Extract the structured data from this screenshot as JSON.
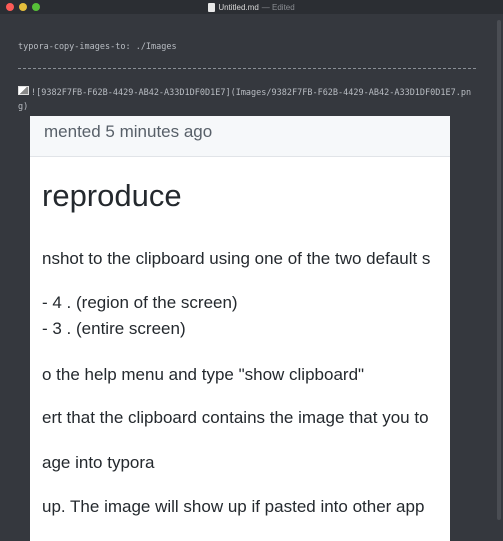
{
  "window": {
    "title": "Untitled.md",
    "status": "— Edited"
  },
  "editor": {
    "frontmatter": "typora-copy-images-to: ./Images",
    "image_markdown": "![9382F7FB-F62B-4429-AB42-A33D1DF0D1E7](Images/9382F7FB-F62B-4429-AB42-A33D1DF0D1E7.png)"
  },
  "screenshot": {
    "header": "mented 5 minutes ago",
    "heading": "reproduce",
    "lines": [
      "nshot to the clipboard using one of the two default s",
      "- 4 . (region of the screen)",
      "- 3 . (entire screen)",
      "o the help menu and type \"show clipboard\"",
      "ert that the clipboard contains the image that you to",
      "age into typora",
      "up. The image will show up if pasted into other app"
    ]
  },
  "colors": {
    "editor_bg": "#35383e",
    "titlebar_bg": "#2b2e33",
    "close": "#fc5b57",
    "minimize": "#e5bf3c",
    "zoom": "#57c038"
  }
}
